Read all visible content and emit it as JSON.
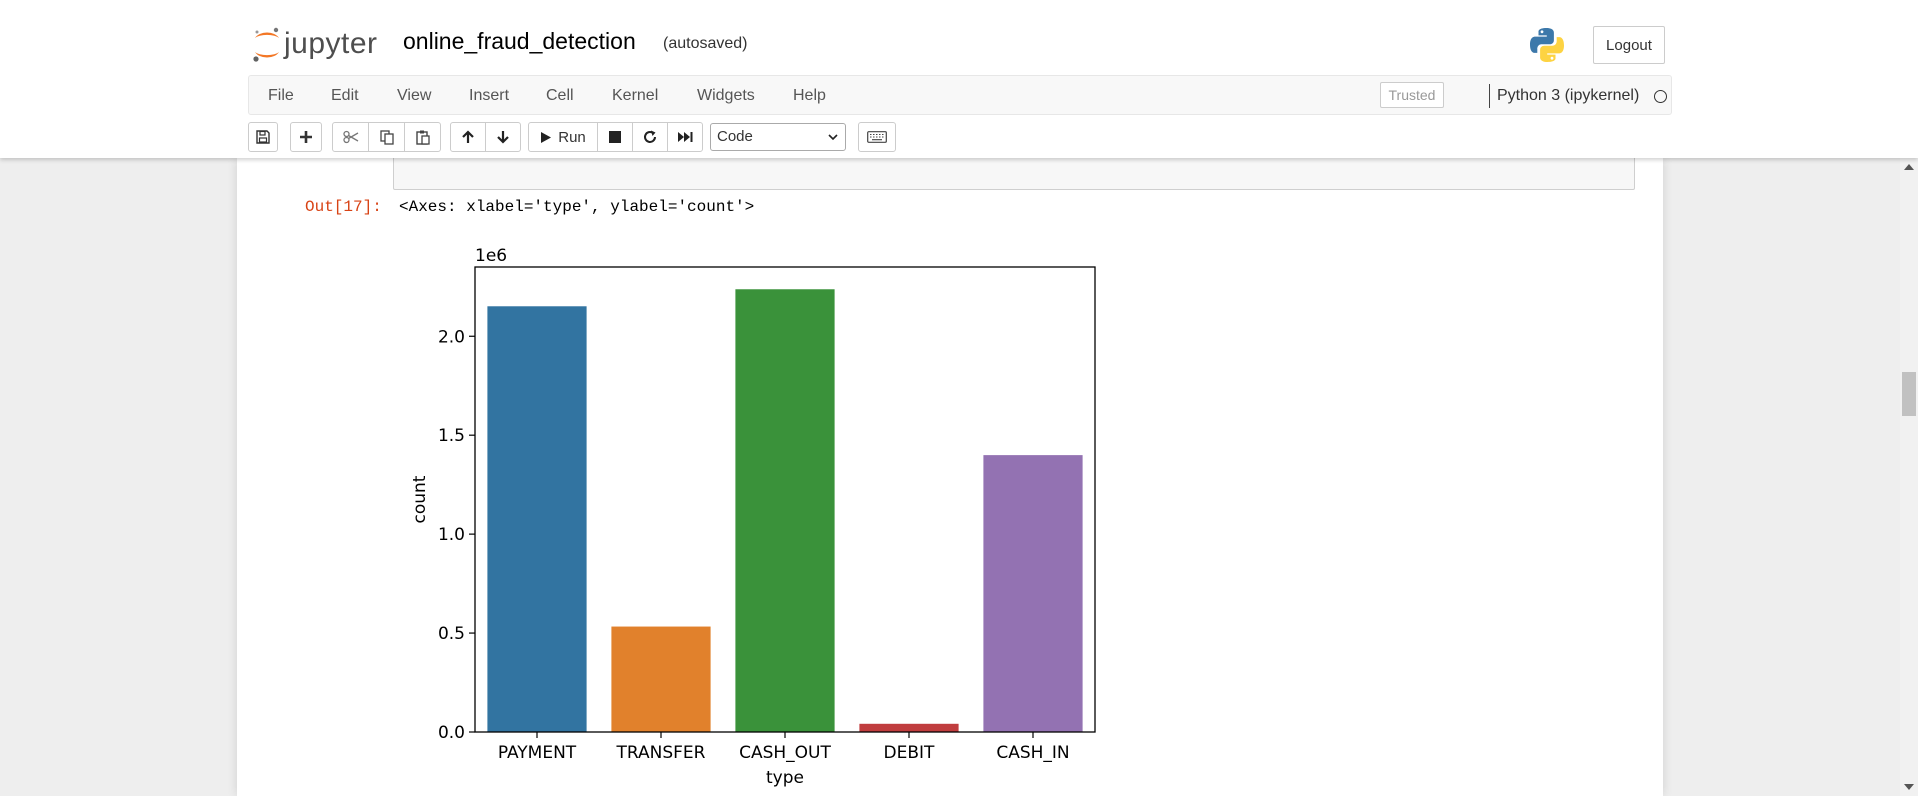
{
  "header": {
    "logo_text": "jupyter",
    "notebook_name": "online_fraud_detection",
    "autosave_status": "(autosaved)",
    "logout_label": "Logout"
  },
  "menubar": {
    "items": [
      "File",
      "Edit",
      "View",
      "Insert",
      "Cell",
      "Kernel",
      "Widgets",
      "Help"
    ],
    "trusted_label": "Trusted",
    "kernel_name": "Python 3 (ipykernel)"
  },
  "toolbar": {
    "run_label": "Run",
    "cell_type": "Code",
    "icons": [
      "save-icon",
      "plus-icon",
      "cut-icon",
      "copy-icon",
      "paste-icon",
      "arrow-up-icon",
      "arrow-down-icon",
      "play-icon",
      "stop-icon",
      "restart-icon",
      "fast-forward-icon",
      "keyboard-icon"
    ]
  },
  "output": {
    "prompt": "Out[17]:",
    "text": "<Axes: xlabel='type', ylabel='count'>"
  },
  "chart_data": {
    "type": "bar",
    "categories": [
      "PAYMENT",
      "TRANSFER",
      "CASH_OUT",
      "DEBIT",
      "CASH_IN"
    ],
    "values": [
      2151495,
      532909,
      2237500,
      41432,
      1399284
    ],
    "colors": [
      "#3274a1",
      "#e1812c",
      "#3a923a",
      "#c03d3e",
      "#9372b2"
    ],
    "xlabel": "type",
    "ylabel": "count",
    "offset_text": "1e6",
    "ylim": [
      0,
      2350000
    ],
    "yticks": [
      0,
      500000,
      1000000,
      1500000,
      2000000
    ],
    "ytick_labels": [
      "0.0",
      "0.5",
      "1.0",
      "1.5",
      "2.0"
    ]
  },
  "colors": {
    "accent_orange": "#f37726",
    "output_prompt": "#d84315"
  }
}
